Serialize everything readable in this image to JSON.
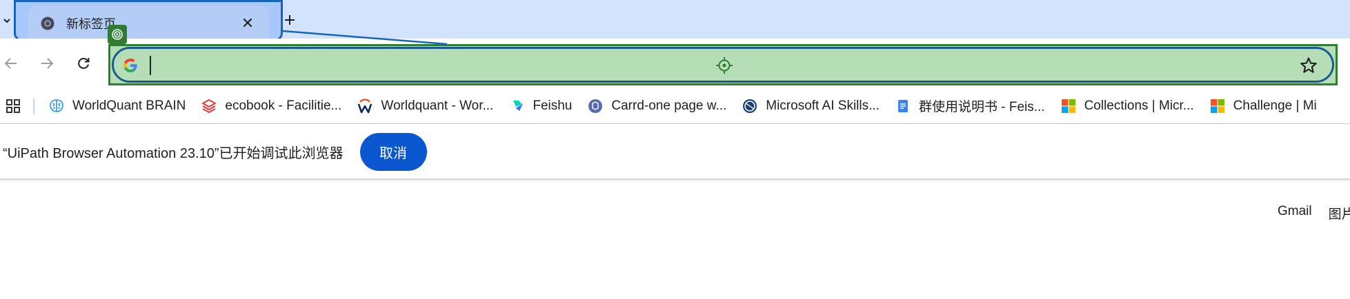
{
  "tabstrip": {
    "tab": {
      "title": "新标签页",
      "favicon": "chrome-icon",
      "close_glyph": "✕"
    },
    "new_tab_glyph": "+",
    "dropdown_icon": "chevron-down-icon"
  },
  "toolbar": {
    "back_icon": "arrow-left-icon",
    "forward_icon": "arrow-right-icon",
    "reload_icon": "reload-icon",
    "omnibox": {
      "value": "",
      "search_engine_icon": "google-g-icon",
      "bookmark_icon": "star-icon",
      "highlight_color": "#b5deb7"
    }
  },
  "bookmarks": [
    {
      "label": "WorldQuant BRAIN",
      "icon": "brain-icon"
    },
    {
      "label": "ecobook - Facilitie...",
      "icon": "ecobook-icon"
    },
    {
      "label": "Worldquant - Wor...",
      "icon": "worldquant-icon"
    },
    {
      "label": "Feishu",
      "icon": "feishu-icon"
    },
    {
      "label": "Carrd-one page w...",
      "icon": "carrd-icon"
    },
    {
      "label": "Microsoft AI Skills...",
      "icon": "globe-icon"
    },
    {
      "label": "群使用说明书 - Feis...",
      "icon": "document-icon"
    },
    {
      "label": "Collections | Micr...",
      "icon": "microsoft-icon"
    },
    {
      "label": "Challenge | Mi",
      "icon": "microsoft-icon"
    }
  ],
  "infobar": {
    "message": "“UiPath Browser Automation 23.10”已开始调试此浏览器",
    "cancel_label": "取消"
  },
  "page": {
    "links": [
      {
        "label": "Gmail"
      },
      {
        "label": "图片"
      }
    ]
  },
  "colors": {
    "accent": "#0b57d0",
    "tabstrip_bg": "#d3e3fd",
    "highlight_green": "#2e7d32"
  }
}
